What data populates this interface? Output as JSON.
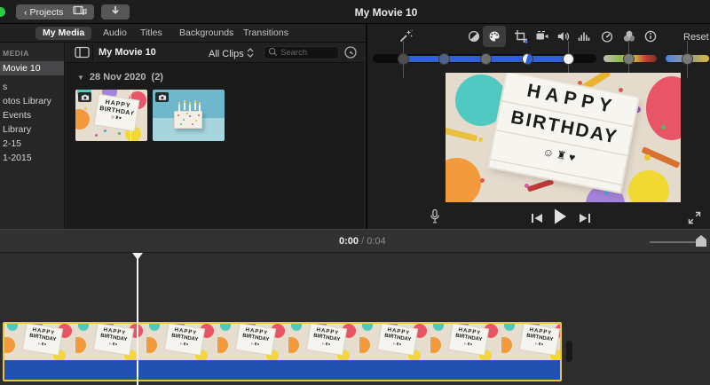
{
  "topbar": {
    "back_chevron": "‹",
    "projects_label": "Projects",
    "title": "My Movie 10"
  },
  "tabs": [
    {
      "label": "My Media",
      "selected": true
    },
    {
      "label": "Audio",
      "selected": false
    },
    {
      "label": "Titles",
      "selected": false
    },
    {
      "label": "Backgrounds",
      "selected": false
    },
    {
      "label": "Transitions",
      "selected": false
    }
  ],
  "sidebar": {
    "header": "MEDIA",
    "items": [
      {
        "label": "Movie 10",
        "selected": true
      },
      {
        "label": "s",
        "selected": false
      },
      {
        "label": "otos Library",
        "selected": false
      },
      {
        "label": "Events",
        "selected": false
      },
      {
        "label": "Library",
        "selected": false
      },
      {
        "label": "2-15",
        "selected": false
      },
      {
        "label": "1-2015",
        "selected": false
      }
    ]
  },
  "browser": {
    "title": "My Movie 10",
    "clips_filter": "All Clips",
    "search_placeholder": "Search",
    "group_disclosure": "▼",
    "group_label": "28 Nov 2020",
    "group_count": "(2)"
  },
  "adjust": {
    "reset_label": "Reset",
    "selected_tool": "color-correction"
  },
  "viewer": {
    "lightbox_line1": "HAPPY",
    "lightbox_line2": "BIRTHDAY",
    "lightbox_emojis": "☺ ♜ ♥"
  },
  "frame": {
    "line1": "HAPPY",
    "line2": "BIRTHDAY",
    "emojis": "☺♜♥"
  },
  "timeline": {
    "time_current": "0:00",
    "time_separator": "/",
    "time_total": "0:04"
  },
  "colors": {
    "slider_blue": "#3160d6",
    "clip_audio_blue": "#2152b2",
    "selection_yellow": "#e6c83e",
    "traffic_green": "#2ecc46",
    "panel_dark": "#1e1e1e"
  }
}
